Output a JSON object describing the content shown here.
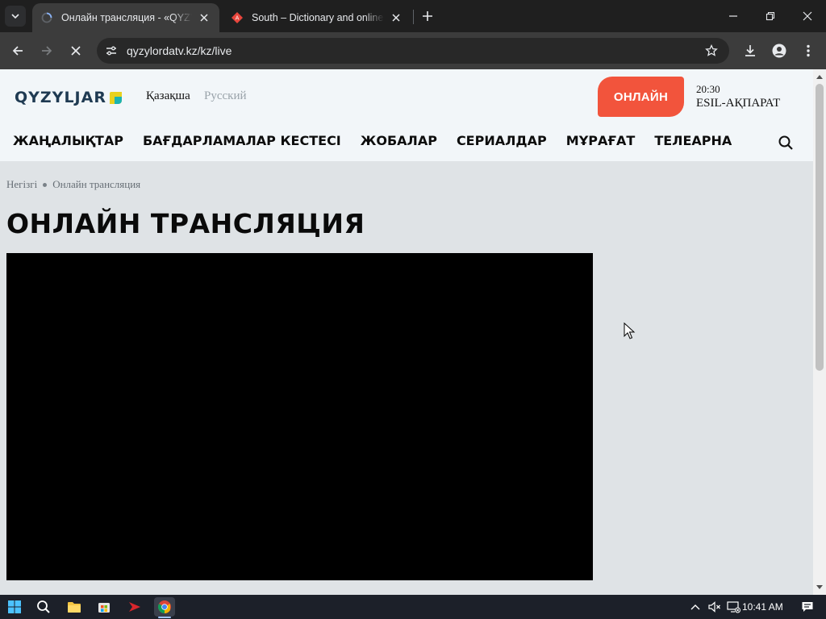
{
  "browser": {
    "tabs": [
      {
        "title": "Онлайн трансляция - «QYZYLJAR»",
        "active": true
      },
      {
        "title": "South – Dictionary and online translation",
        "active": false
      }
    ],
    "address": "qyzylordatv.kz/kz/live"
  },
  "site": {
    "logo_text": "QYZYLJAR",
    "languages": {
      "kz": "Қазақша",
      "ru": "Русский"
    },
    "live_button": "ОНЛАЙН",
    "now_playing": {
      "time": "20:30",
      "title": "ESIL-АҚПАРАТ"
    },
    "menu": [
      "ЖАҢАЛЫҚТАР",
      "БАҒДАРЛАМАЛАР КЕСТЕСІ",
      "ЖОБАЛАР",
      "СЕРИАЛДАР",
      "МҰРАҒАТ",
      "ТЕЛЕАРНА"
    ]
  },
  "page": {
    "breadcrumb": [
      "Негізгі",
      "Онлайн трансляция"
    ],
    "title": "ОНЛАЙН ТРАНСЛЯЦИЯ"
  },
  "taskbar": {
    "time": "10:41 AM"
  },
  "colors": {
    "accent": "#f2543c",
    "logo": "#1f3a52",
    "logo_mark_yellow": "#e8d11e",
    "logo_mark_teal": "#1bb3b1",
    "page_bg": "#dfe3e6",
    "header_bg": "#f2f6f9"
  }
}
